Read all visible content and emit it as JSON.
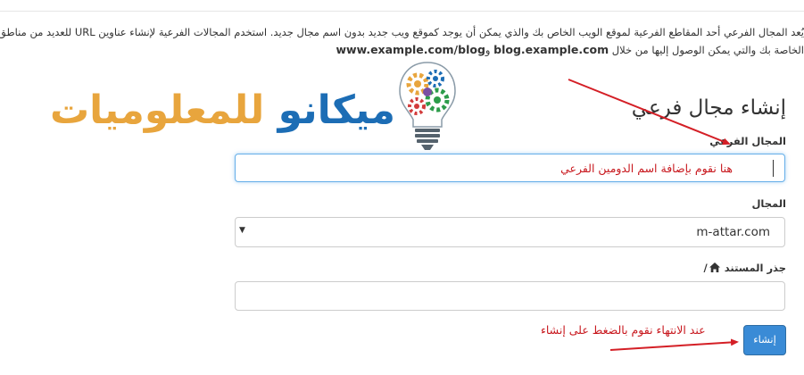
{
  "intro": {
    "line1": "يُعد المجال الفرعي أحد المقاطع الفرعية لموقع الويب الخاص بك والذي يمكن أن يوجد كموقع ويب جديد بدون اسم مجال جديد. استخدم المجالات الفرعية لإنشاء عناوين URL للعديد من مناطق المحتوى",
    "line2_prefix": "الخاصة بك والتي يمكن الوصول إليها من خلال",
    "line2_url1": "blog.example.com",
    "line2_conj": "و",
    "line2_url2": "www.example.com/blog"
  },
  "logo": {
    "word1": "ميكانو",
    "word2": "للمعلوميات",
    "colors": {
      "blue": "#1c6db5",
      "orange": "#e8a53d"
    }
  },
  "form": {
    "title": "إنشاء مجال فرعي",
    "subdomain_label": "المجال الفرعي",
    "subdomain_value": "",
    "subdomain_annotation": "هنا نقوم بإضافة اسم الدومين الفرعي",
    "domain_label": "المجال",
    "domain_selected": "m-attar.com",
    "document_root_label": "جذر المستند",
    "document_root_icon": "home-icon",
    "document_root_value": "",
    "create_button": "إنشاء",
    "create_annotation": "عند الانتهاء نقوم بالضغط على إنشاء"
  },
  "colors": {
    "annotation_red": "#c8181e",
    "button_blue": "#3a8bd6",
    "focus_blue": "#66afe9"
  }
}
